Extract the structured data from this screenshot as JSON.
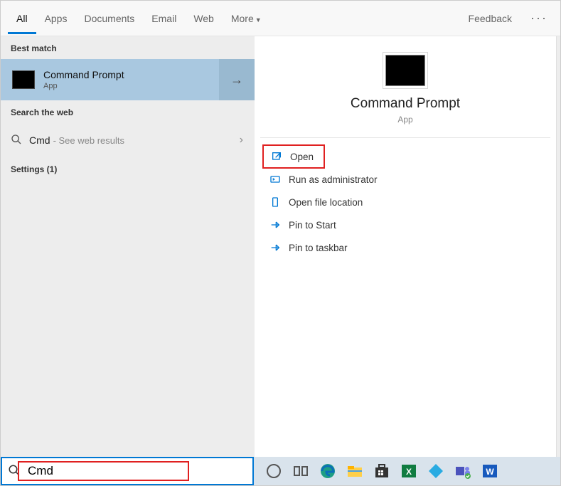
{
  "tabs": {
    "all": "All",
    "apps": "Apps",
    "documents": "Documents",
    "email": "Email",
    "web": "Web",
    "more": "More",
    "feedback": "Feedback"
  },
  "sections": {
    "best_match": "Best match",
    "search_web": "Search the web",
    "settings_label": "Settings (1)"
  },
  "best_match_result": {
    "title": "Command Prompt",
    "subtitle": "App"
  },
  "web_result": {
    "query": "Cmd",
    "hint": "- See web results"
  },
  "preview": {
    "title": "Command Prompt",
    "subtitle": "App"
  },
  "actions": {
    "open": "Open",
    "run_admin": "Run as administrator",
    "file_location": "Open file location",
    "pin_start": "Pin to Start",
    "pin_taskbar": "Pin to taskbar"
  },
  "search": {
    "value": "Cmd"
  },
  "taskbar_icons": [
    "cortana",
    "task-view",
    "edge",
    "file-explorer",
    "store",
    "excel",
    "kodi",
    "teams",
    "word"
  ]
}
